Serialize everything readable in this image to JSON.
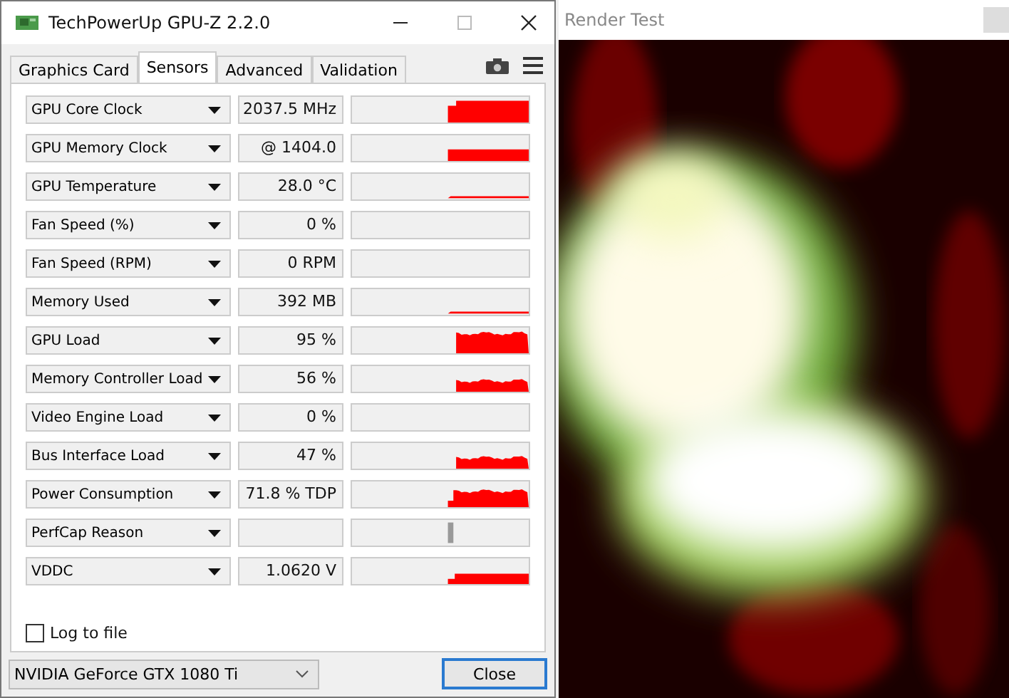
{
  "gpuz_window": {
    "title": "TechPowerUp GPU-Z 2.2.0",
    "tabs": [
      {
        "label": "Graphics Card",
        "selected": false
      },
      {
        "label": "Sensors",
        "selected": true
      },
      {
        "label": "Advanced",
        "selected": false
      },
      {
        "label": "Validation",
        "selected": false
      }
    ],
    "sensors": [
      {
        "name": "GPU Core Clock",
        "value": "2037.5 MHz",
        "kind": "stephigh"
      },
      {
        "name": "GPU Memory Clock",
        "value": "@ 1404.0",
        "kind": "block"
      },
      {
        "name": "GPU Temperature",
        "value": "28.0 °C",
        "kind": "lowline"
      },
      {
        "name": "Fan Speed (%)",
        "value": "0 %",
        "kind": "empty"
      },
      {
        "name": "Fan Speed (RPM)",
        "value": "0 RPM",
        "kind": "empty"
      },
      {
        "name": "Memory Used",
        "value": "392 MB",
        "kind": "lowline"
      },
      {
        "name": "GPU Load",
        "value": "95 %",
        "kind": "noisyhigh"
      },
      {
        "name": "Memory Controller Load",
        "value": "56 %",
        "kind": "noisymid"
      },
      {
        "name": "Video Engine Load",
        "value": "0 %",
        "kind": "empty"
      },
      {
        "name": "Bus Interface Load",
        "value": "47 %",
        "kind": "noisymid"
      },
      {
        "name": "Power Consumption",
        "value": "71.8 % TDP",
        "kind": "stepnoisy"
      },
      {
        "name": "PerfCap Reason",
        "kind": "marker"
      },
      {
        "name": "VDDC",
        "value": "1.0620 V",
        "kind": "steplow"
      }
    ],
    "log_to_file": {
      "label": "Log to file",
      "checked": false
    },
    "gpu_select": {
      "value": "NVIDIA GeForce GTX 1080 Ti"
    },
    "close_button": "Close"
  },
  "render_window": {
    "title": "Render Test"
  }
}
